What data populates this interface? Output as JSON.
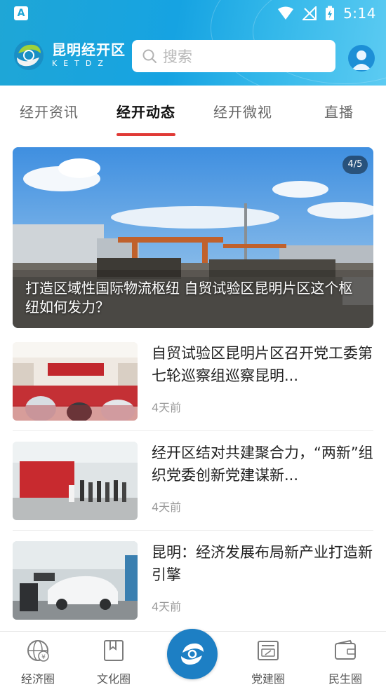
{
  "statusbar": {
    "app_badge": "A",
    "time": "5:14"
  },
  "header": {
    "logo_cn": "昆明经开区",
    "logo_en": "KETDZ",
    "search_placeholder": "搜索"
  },
  "tabs": [
    {
      "label": "经开资讯",
      "active": false
    },
    {
      "label": "经开动态",
      "active": true
    },
    {
      "label": "经开微视",
      "active": false
    },
    {
      "label": "直播",
      "active": false
    }
  ],
  "banner": {
    "counter": "4/5",
    "title": "打造区域性国际物流枢纽 自贸试验区昆明片区这个枢纽如何发力？"
  },
  "news": [
    {
      "title": "自贸试验区昆明片区召开党工委第七轮巡察组巡察昆明...",
      "time": "4天前"
    },
    {
      "title": "经开区结对共建聚合力，“两新”组织党委创新党建谋新...",
      "time": "4天前"
    },
    {
      "title": "昆明：经济发展布局新产业打造新引擎",
      "time": "4天前"
    }
  ],
  "bottom_nav": [
    {
      "label": "经济圈",
      "icon": "globe-yen-icon"
    },
    {
      "label": "文化圈",
      "icon": "bookmark-book-icon"
    },
    {
      "label": "",
      "icon": "ketdz-logo-icon"
    },
    {
      "label": "党建圈",
      "icon": "party-card-icon"
    },
    {
      "label": "民生圈",
      "icon": "wallet-icon"
    }
  ],
  "colors": {
    "header_blue": "#1fa6d6",
    "accent_red": "#e03a36",
    "center_blue": "#1d7fc4"
  }
}
